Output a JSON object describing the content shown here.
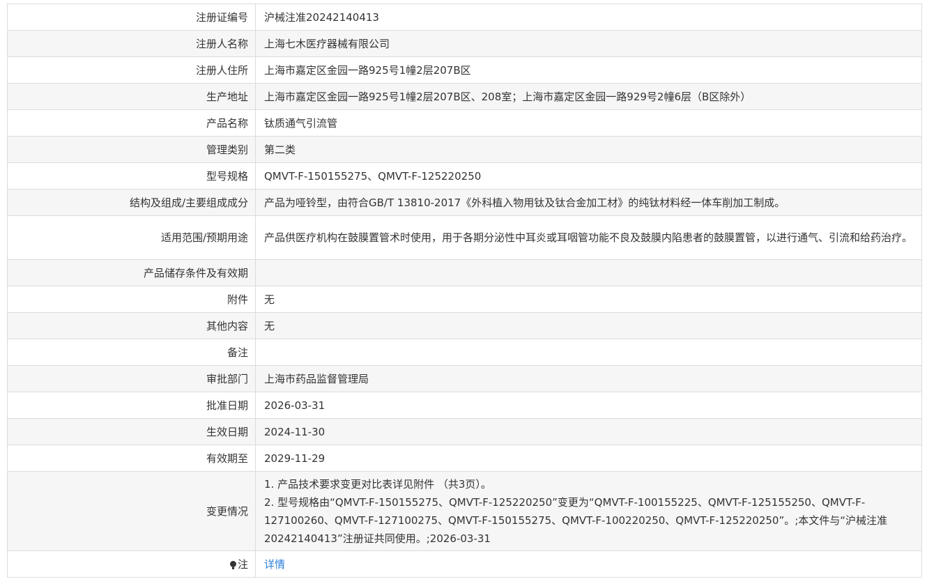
{
  "rows": [
    {
      "label": "注册证编号",
      "value": "沪械注准20242140413"
    },
    {
      "label": "注册人名称",
      "value": "上海七木医疗器械有限公司"
    },
    {
      "label": "注册人住所",
      "value": "上海市嘉定区金园一路925号1幢2层207B区"
    },
    {
      "label": "生产地址",
      "value": "上海市嘉定区金园一路925号1幢2层207B区、208室；上海市嘉定区金园一路929号2幢6层（B区除外）"
    },
    {
      "label": "产品名称",
      "value": "钛质通气引流管"
    },
    {
      "label": "管理类别",
      "value": "第二类"
    },
    {
      "label": "型号规格",
      "value": "QMVT-F-150155275、QMVT-F-125220250"
    },
    {
      "label": "结构及组成/主要组成成分",
      "value": "产品为哑铃型，由符合GB/T 13810-2017《外科植入物用钛及钛合金加工材》的纯钛材料经一体车削加工制成。"
    },
    {
      "label": "适用范围/预期用途",
      "value": "产品供医疗机构在鼓膜置管术时使用，用于各期分泌性中耳炎或耳咽管功能不良及鼓膜内陷患者的鼓膜置管，以进行通气、引流和给药治疗。"
    },
    {
      "label": "产品储存条件及有效期",
      "value": ""
    },
    {
      "label": "附件",
      "value": "无"
    },
    {
      "label": "其他内容",
      "value": "无"
    },
    {
      "label": "备注",
      "value": ""
    },
    {
      "label": "审批部门",
      "value": "上海市药品监督管理局"
    },
    {
      "label": "批准日期",
      "value": "2026-03-31"
    },
    {
      "label": "生效日期",
      "value": "2024-11-30"
    },
    {
      "label": "有效期至",
      "value": "2029-11-29"
    }
  ],
  "change": {
    "label": "变更情况",
    "line1": "1. 产品技术要求变更对比表详见附件 （共3页）。",
    "line2": "2. 型号规格由“QMVT-F-150155275、QMVT-F-125220250”变更为“QMVT-F-100155225、QMVT-F-125155250、QMVT-F-127100260、QMVT-F-127100275、QMVT-F-150155275、QMVT-F-100220250、QMVT-F-125220250”。;本文件与“沪械注准20242140413”注册证共同使用。;2026-03-31"
  },
  "note": {
    "label": "注",
    "icon": "bulb-icon",
    "link_text": "详情",
    "link_color": "#2b7ed8"
  }
}
